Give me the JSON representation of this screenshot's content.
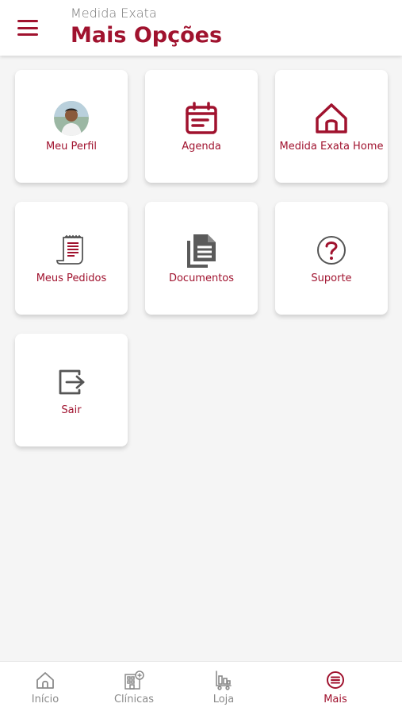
{
  "header": {
    "app_name": "Medida Exata",
    "title": "Mais Opções",
    "menu_icon": "hamburger-menu-icon"
  },
  "tiles": [
    {
      "label": "Meu Perfil",
      "icon": "avatar"
    },
    {
      "label": "Agenda",
      "icon": "calendar-icon"
    },
    {
      "label": "Medida Exata Home",
      "icon": "home-icon"
    },
    {
      "label": "Meus Pedidos",
      "icon": "receipt-icon"
    },
    {
      "label": "Documentos",
      "icon": "documents-icon"
    },
    {
      "label": "Suporte",
      "icon": "help-circle-icon"
    },
    {
      "label": "Sair",
      "icon": "logout-icon"
    }
  ],
  "bottom_nav": [
    {
      "label": "Início",
      "icon": "home-icon",
      "active": false
    },
    {
      "label": "Clínicas",
      "icon": "building-icon",
      "active": false
    },
    {
      "label": "Loja",
      "icon": "store-icon",
      "active": false
    },
    {
      "label": "Mais",
      "icon": "menu-circle-icon",
      "active": true
    }
  ],
  "colors": {
    "brand": "#a0122e",
    "background": "#f5f5f5",
    "inactive_nav": "#8a8a8a"
  }
}
